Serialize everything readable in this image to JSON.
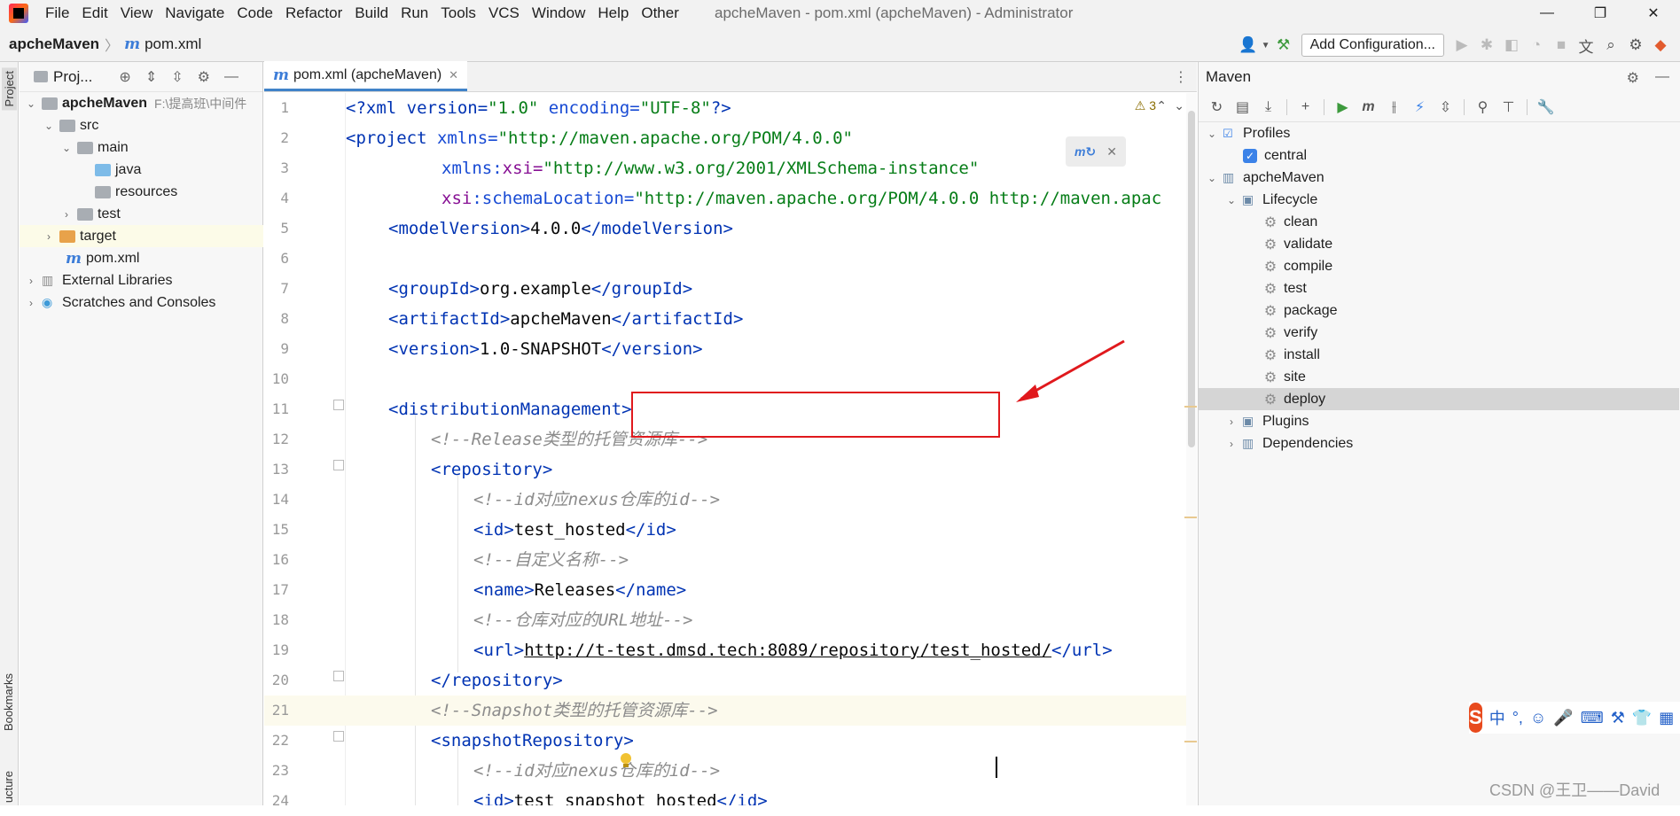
{
  "app": {
    "menu": [
      "File",
      "Edit",
      "View",
      "Navigate",
      "Code",
      "Refactor",
      "Build",
      "Run",
      "Tools",
      "VCS",
      "Window",
      "Help",
      "Other"
    ],
    "title": "apcheMaven - pom.xml (apcheMaven) - Administrator",
    "window_controls": [
      "—",
      "❐",
      "✕"
    ]
  },
  "breadcrumb": {
    "project": "apcheMaven",
    "file": "pom.xml"
  },
  "toolbar": {
    "add_configuration": "Add Configuration..."
  },
  "sidebar_strip": {
    "project": "Project",
    "bookmarks": "Bookmarks",
    "structure": "ucture"
  },
  "project_panel": {
    "title": "Proj...",
    "tree": [
      {
        "label": "apcheMaven",
        "path": "F:\\提高班\\中间件",
        "level": 0,
        "icon": "folder-gray",
        "expanded": true
      },
      {
        "label": "src",
        "level": 1,
        "icon": "folder-gray",
        "expanded": true
      },
      {
        "label": "main",
        "level": 2,
        "icon": "folder-gray",
        "expanded": true
      },
      {
        "label": "java",
        "level": 3,
        "icon": "folder-blue"
      },
      {
        "label": "resources",
        "level": 3,
        "icon": "folder-gray"
      },
      {
        "label": "test",
        "level": 2,
        "icon": "folder-gray",
        "expanded": false
      },
      {
        "label": "target",
        "level": 1,
        "icon": "folder-orange",
        "expanded": false
      },
      {
        "label": "pom.xml",
        "level": 1,
        "icon": "m-icon"
      },
      {
        "label": "External Libraries",
        "level": 0,
        "icon": "library-icon",
        "expanded": false
      },
      {
        "label": "Scratches and Consoles",
        "level": 0,
        "icon": "scratch-icon",
        "expanded": false
      }
    ]
  },
  "editor": {
    "tab": "pom.xml (apcheMaven)",
    "warnings": "3",
    "lines": [
      "1",
      "2",
      "3",
      "4",
      "5",
      "6",
      "7",
      "8",
      "9",
      "10",
      "11",
      "12",
      "13",
      "14",
      "15",
      "16",
      "17",
      "18",
      "19",
      "20",
      "21",
      "22",
      "23",
      "24"
    ],
    "code": {
      "l1_a": "<?xml version=",
      "l1_b": "\"1.0\"",
      "l1_c": " encoding=",
      "l1_d": "\"UTF-8\"",
      "l1_e": "?>",
      "l2_a": "<project ",
      "l2_b": "xmlns=",
      "l2_c": "\"http://maven.apache.org/POM/4.0.0\"",
      "l3_a": "xmlns:",
      "l3_b": "xsi=",
      "l3_c": "\"http://www.w3.org/2001/XMLSchema-instance\"",
      "l4_a": "xsi",
      "l4_b": ":schemaLocation=",
      "l4_c": "\"http://maven.apache.org/POM/4.0.0 http://maven.apac",
      "l5_a": "<modelVersion>",
      "l5_b": "4.0.0",
      "l5_c": "</modelVersion>",
      "l7_a": "<groupId>",
      "l7_b": "org.example",
      "l7_c": "</groupId>",
      "l8_a": "<artifactId>",
      "l8_b": "apcheMaven",
      "l8_c": "</artifactId>",
      "l9_a": "<version>",
      "l9_b": "1.0-SNAPSHOT",
      "l9_c": "</version>",
      "l11": "<distributionManagement>",
      "l12": "<!--Release类型的托管资源库-->",
      "l13": "<repository>",
      "l14": "<!--id对应nexus仓库的id-->",
      "l15_a": "<id>",
      "l15_b": "test_hosted",
      "l15_c": "</id>",
      "l16": "<!--自定义名称-->",
      "l17_a": "<name>",
      "l17_b": "Releases",
      "l17_c": "</name>",
      "l18": "<!--仓库对应的URL地址-->",
      "l19_a": "<url>",
      "l19_b": "http://t-test.dmsd.tech:8089/repository/test_hosted/",
      "l19_c": "</url>",
      "l20": "</repository>",
      "l21": "<!--Snapshot类型的托管资源库-->",
      "l22": "<snapshotRepository>",
      "l23": "<!--id对应nexus仓库的id-->",
      "l24_a": "<id>",
      "l24_b": "test_snapshot_hosted",
      "l24_c": "</id>"
    }
  },
  "maven_panel": {
    "title": "Maven",
    "profiles_label": "Profiles",
    "profile": "central",
    "project": "apcheMaven",
    "lifecycle_label": "Lifecycle",
    "lifecycle": [
      "clean",
      "validate",
      "compile",
      "test",
      "package",
      "verify",
      "install",
      "site",
      "deploy"
    ],
    "plugins_label": "Plugins",
    "dependencies_label": "Dependencies"
  },
  "ime": {
    "lang": "中",
    "punct": "°,"
  },
  "watermark": "CSDN @王卫——David"
}
